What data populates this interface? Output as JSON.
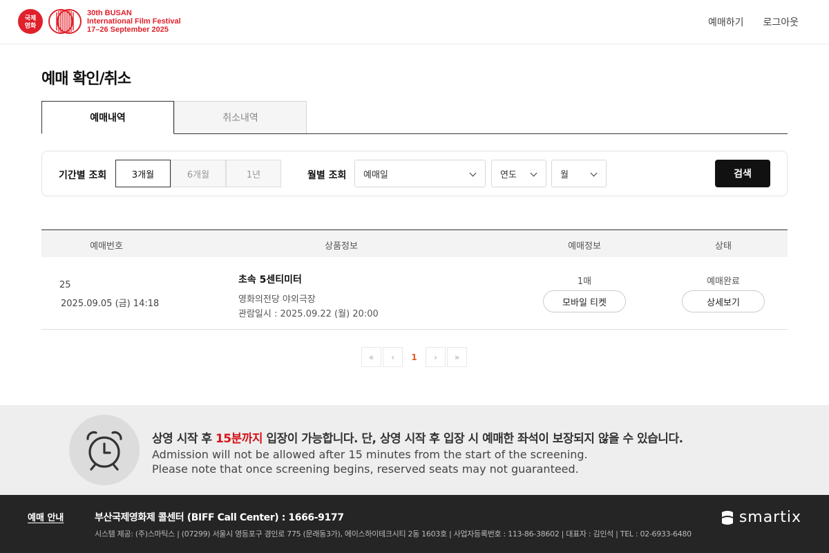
{
  "header": {
    "logo_glyph": "국제영화제",
    "logo_lines": [
      "30th BUSAN",
      "International Film Festival",
      "17–26 September 2025"
    ],
    "nav": [
      {
        "label": "예매하기"
      },
      {
        "label": "로그아웃"
      }
    ]
  },
  "page_title": "예매 확인/취소",
  "tabs": [
    {
      "label": "예매내역",
      "active": true
    },
    {
      "label": "취소내역",
      "active": false
    }
  ],
  "filter": {
    "period_label": "기간별 조회",
    "period_options": [
      "3개월",
      "6개월",
      "1년"
    ],
    "period_selected": "3개월",
    "monthly_label": "월별 조회",
    "date_type": "예매일",
    "year": "연도",
    "month": "월",
    "search_label": "검색"
  },
  "table": {
    "headers": [
      "예매번호",
      "상품정보",
      "예매정보",
      "상태"
    ],
    "rows": [
      {
        "booking_no": "25",
        "booking_date": "2025.09.05 (금) 14:18",
        "title": "초속 5센티미터",
        "venue": "영화의전당 야외극장",
        "show_date": "관람일시 : 2025.09.22 (월) 20:00",
        "quantity": "1매",
        "ticket_button": "모바일 티켓",
        "status": "예매완료",
        "detail_button": "상세보기"
      }
    ]
  },
  "pagination": {
    "first": "«",
    "prev": "‹",
    "current": "1",
    "next": "›",
    "last": "»"
  },
  "notice": {
    "ko_before": "상영 시작 후 ",
    "ko_highlight": "15분까지",
    "ko_after": " 입장이 가능합니다. 단, 상영 시작 후 입장 시 예매한 좌석이 보장되지 않을 수 있습니다.",
    "en_line1": "Admission will not be allowed after 15 minutes from the start of the screening.",
    "en_line2": "Please note that once screening begins, reserved seats may not guaranteed.",
    "icon": "alarm-clock-icon"
  },
  "footer": {
    "guide_label": "예매 안내",
    "call_center": "부산국제영화제 콜센터 (BIFF Call Center) : 1666-9177",
    "info": "시스템 제공: (주)스마틱스   |   (07299) 서울시 영등포구 경인로 775 (문래동3가), 에이스하이테크시티 2동 1603호   |   사업자등록번호 : 113-86-38602   |   대표자 : 김인석   |   TEL : 02-6933-6480",
    "brand": "smartix"
  },
  "colors": {
    "accent": "#e0202a",
    "highlight": "#d4141b",
    "page_current": "#e45a1e",
    "footer_bg": "#252525"
  }
}
